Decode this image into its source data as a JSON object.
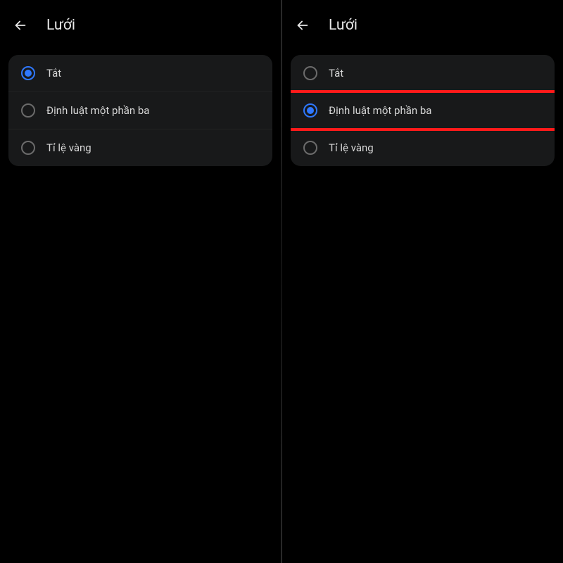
{
  "left": {
    "header": {
      "title": "Lưới"
    },
    "options": {
      "0": {
        "label": "Tắt"
      },
      "1": {
        "label": "Định luật một phần ba"
      },
      "2": {
        "label": "Tỉ lệ vàng"
      }
    }
  },
  "right": {
    "header": {
      "title": "Lưới"
    },
    "options": {
      "0": {
        "label": "Tắt"
      },
      "1": {
        "label": "Định luật một phần ba"
      },
      "2": {
        "label": "Tỉ lệ vàng"
      }
    }
  },
  "colors": {
    "accent": "#2f78ff",
    "option_bg": "#18191a",
    "highlight": "#ff1a1a"
  }
}
